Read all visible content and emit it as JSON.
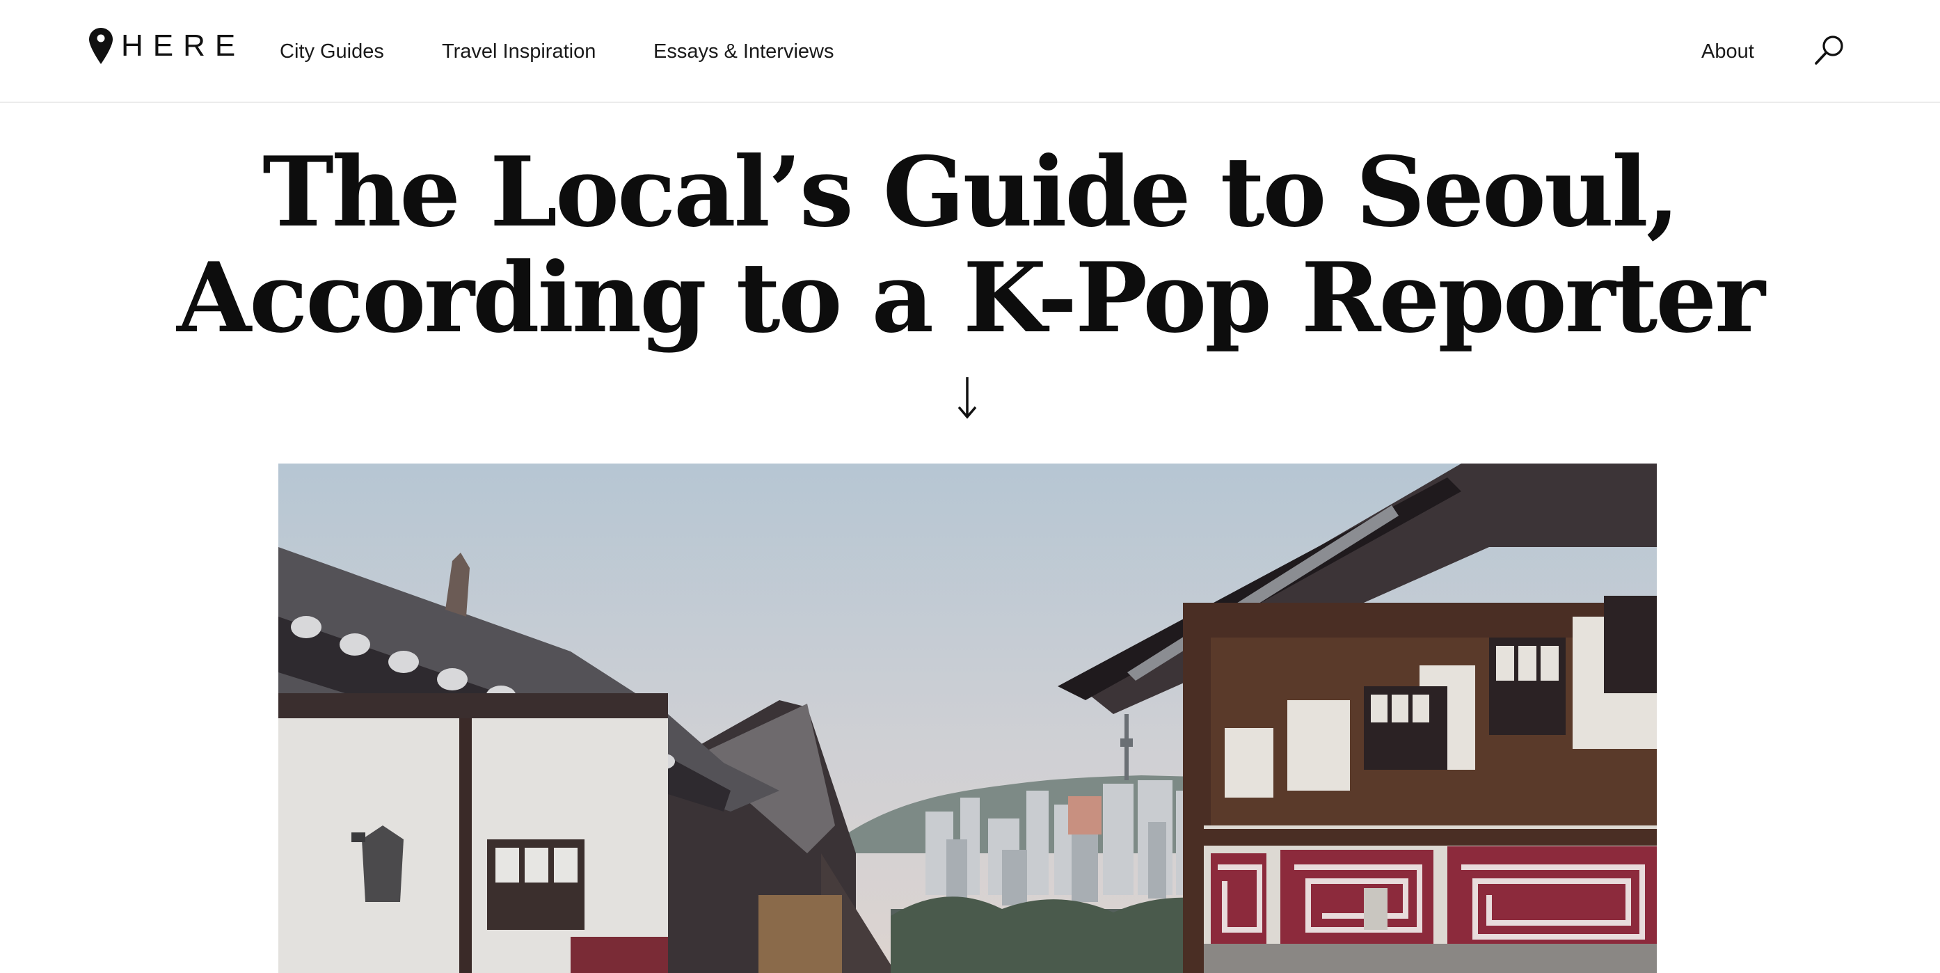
{
  "header": {
    "logo_text": "HERE",
    "logo_icon": "location-pin-icon",
    "nav": [
      {
        "label": "City Guides"
      },
      {
        "label": "Travel Inspiration"
      },
      {
        "label": "Essays & Interviews"
      }
    ],
    "about_label": "About",
    "search_icon": "search-icon"
  },
  "article": {
    "title": "The Local’s Guide to Seoul, According to a K-Pop Reporter",
    "scroll_icon": "arrow-down-icon",
    "hero_image": {
      "subject": "hanok-rooftops-seoul-skyline",
      "colors": {
        "sky_top": "#b7c7d3",
        "sky_bottom": "#d8d3d2",
        "roof_dark": "#2b2226",
        "wall_red": "#8c2a3c"
      }
    }
  }
}
